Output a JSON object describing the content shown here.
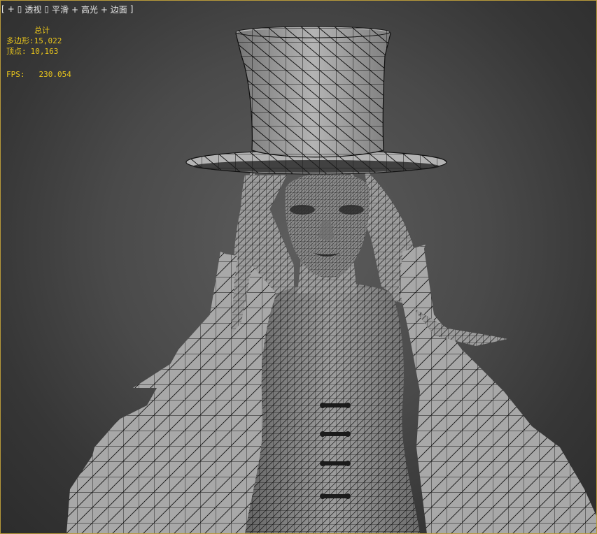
{
  "viewport": {
    "label": {
      "open_bracket": "[",
      "plus": "+",
      "view": "透视",
      "shading": "平滑",
      "highlights": "+ 高光",
      "edged_faces": "+ 边面",
      "close_bracket": "]"
    },
    "stats": {
      "title": "总计",
      "polygons_label": "多边形:",
      "polygons_value": "15,022",
      "vertices_label": "顶点:",
      "vertices_value": "10,163",
      "fps_label": "FPS:",
      "fps_value": "230.054"
    },
    "colors": {
      "stats_text": "#e9c51c",
      "frame_border": "#b89a3a",
      "mesh_fill": "#9a9a9a",
      "mesh_wire": "#111111"
    }
  }
}
